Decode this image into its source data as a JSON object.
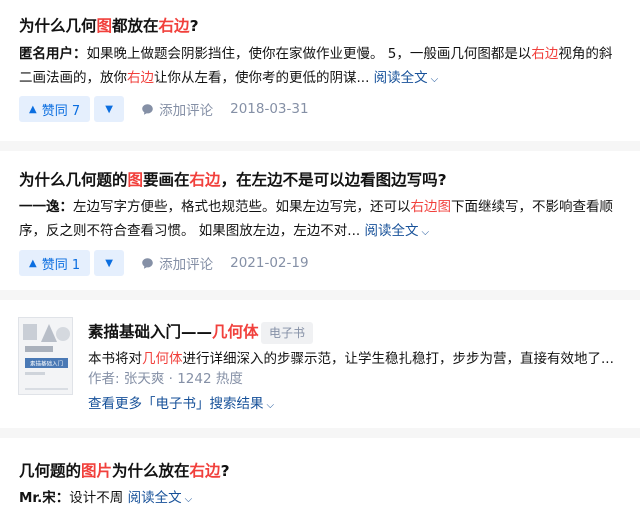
{
  "results": [
    {
      "title_parts": [
        "为什么几何",
        "图",
        "都放在",
        "右边",
        "?"
      ],
      "author": "匿名用户",
      "excerpt_parts": [
        "如果晚上做题会阴影挡住，使你在家做作业更慢。 5，一般画几何图都是以",
        "右边",
        "视角的斜二画法画的，放你",
        "右边",
        "让你从左看，使你考的更低的阴谋... "
      ],
      "read_more": "阅读全文",
      "vote_label": "赞同 7",
      "comment_label": "添加评论",
      "date": "2018-03-31"
    },
    {
      "title_parts": [
        "为什么几何题的",
        "图",
        "要画在",
        "右边",
        "，在左边不是可以边看图边写吗?"
      ],
      "author": "一一逸",
      "excerpt_parts": [
        "左边写字方便些，格式也规范些。如果左边写完，还可以",
        "右边图",
        "下面继续写，不影响查看顺序，反之则不符合查看习惯。 如果图放左边，左边不对... "
      ],
      "read_more": "阅读全文",
      "vote_label": "赞同 1",
      "comment_label": "添加评论",
      "date": "2021-02-19"
    }
  ],
  "ebook": {
    "title_prefix": "素描基础入门——",
    "title_highlight": "几何体",
    "tag": "电子书",
    "desc_prefix": "本书将对",
    "desc_highlight": "几何体",
    "desc_rest": "进行详细深入的步骤示范，让学生稳扎稳打，步步为营，直接有效地了...",
    "meta": "作者: 张天爽 · 1242 热度",
    "see_more": "查看更多「电子书」搜索结果",
    "cover_text": "素描基础入门"
  },
  "last": {
    "title_parts": [
      "几何题的",
      "图片",
      "为什么放在",
      "右边",
      "?"
    ],
    "author": "Mr.宋",
    "excerpt": "设计不周 ",
    "read_more": "阅读全文"
  },
  "colors": {
    "highlight": "#f1403c",
    "link": "#175199",
    "vote": "#0b6ee0"
  }
}
